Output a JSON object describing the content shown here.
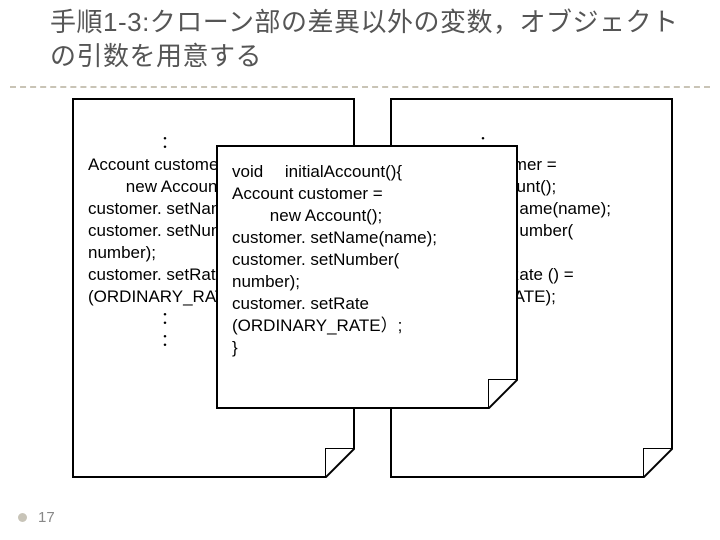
{
  "title": "手順1-3:クローン部の差異以外の変数，オブジェクトの引数を用意する",
  "left_code": "\n 　　　　：\nAccount customer =\n        new Account();\ncustomer. setName(name);\ncustomer. setNumber(\nnumber);\ncustomer. setRate\n(ORDINARY_RATE）;\n 　　　　：\n 　　　　：",
  "right_code": "\n 　　　　：\nAccount customer =\n        new Account();\ncustomer. setName(name);\ncustomer. setNumber(\nnumber);\ncustomer. setRate () =\n(STUDENT_RATE);\n 　　　　：\n 　　　　：",
  "front_code": "void 　initialAccount(){\nAccount customer =\n        new Account();\ncustomer. setName(name);\ncustomer. setNumber(\nnumber);\ncustomer. setRate\n(ORDINARY_RATE）;\n}",
  "page": "17"
}
